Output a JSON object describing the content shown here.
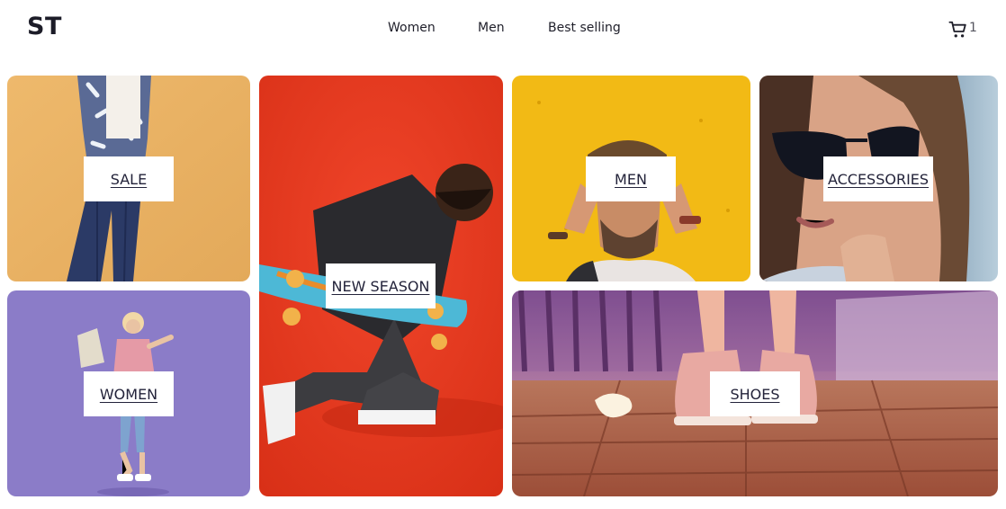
{
  "header": {
    "logo": "ST",
    "nav": [
      "Women",
      "Men",
      "Best selling"
    ],
    "cart_count": "1"
  },
  "tiles": {
    "sale": "SALE",
    "new_season": "NEW SEASON",
    "men": "MEN",
    "accessories": "ACCESSORIES",
    "women": "WOMEN",
    "shoes": "SHOES"
  },
  "icons": {
    "cart": "shopping-cart-icon"
  },
  "colors": {
    "sale_bg": "#e9b266",
    "women_bg": "#8b7cc8",
    "new_season_bg": "#e63a1e",
    "men_bg": "#f2b512",
    "accessories_bg": "#9fb4c4",
    "shoes_bg": "#b0624a"
  }
}
